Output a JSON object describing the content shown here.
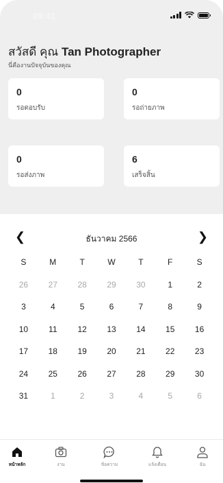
{
  "status_bar": {
    "time": "09:41"
  },
  "header": {
    "greeting_prefix": "สวัสดี คุณ",
    "user_name": "Tan Photographer",
    "subtitle": "นี่คืองานปัจจุบันของคุณ"
  },
  "stats": [
    {
      "value": "0",
      "label": "รอตอบรับ"
    },
    {
      "value": "0",
      "label": "รอถ่ายภาพ"
    },
    {
      "value": "0",
      "label": "รอส่งภาพ"
    },
    {
      "value": "6",
      "label": "เสร็จสิ้น"
    }
  ],
  "calendar": {
    "month_title": "ธันวาคม 2566",
    "prev_icon": "chevron-left-icon",
    "next_icon": "chevron-right-icon",
    "weekdays": [
      "S",
      "M",
      "T",
      "W",
      "T",
      "F",
      "S"
    ],
    "weeks": [
      [
        {
          "d": "26",
          "m": true
        },
        {
          "d": "27",
          "m": true
        },
        {
          "d": "28",
          "m": true
        },
        {
          "d": "29",
          "m": true
        },
        {
          "d": "30",
          "m": true
        },
        {
          "d": "1",
          "m": false
        },
        {
          "d": "2",
          "m": false
        }
      ],
      [
        {
          "d": "3",
          "m": false
        },
        {
          "d": "4",
          "m": false
        },
        {
          "d": "5",
          "m": false
        },
        {
          "d": "6",
          "m": false
        },
        {
          "d": "7",
          "m": false
        },
        {
          "d": "8",
          "m": false
        },
        {
          "d": "9",
          "m": false
        }
      ],
      [
        {
          "d": "10",
          "m": false
        },
        {
          "d": "11",
          "m": false
        },
        {
          "d": "12",
          "m": false
        },
        {
          "d": "13",
          "m": false
        },
        {
          "d": "14",
          "m": false
        },
        {
          "d": "15",
          "m": false
        },
        {
          "d": "16",
          "m": false
        }
      ],
      [
        {
          "d": "17",
          "m": false
        },
        {
          "d": "18",
          "m": false
        },
        {
          "d": "19",
          "m": false
        },
        {
          "d": "20",
          "m": false
        },
        {
          "d": "21",
          "m": false
        },
        {
          "d": "22",
          "m": false
        },
        {
          "d": "23",
          "m": false
        }
      ],
      [
        {
          "d": "24",
          "m": false
        },
        {
          "d": "25",
          "m": false
        },
        {
          "d": "26",
          "m": false
        },
        {
          "d": "27",
          "m": false
        },
        {
          "d": "28",
          "m": false
        },
        {
          "d": "29",
          "m": false
        },
        {
          "d": "30",
          "m": false
        }
      ],
      [
        {
          "d": "31",
          "m": false
        },
        {
          "d": "1",
          "m": true
        },
        {
          "d": "2",
          "m": true
        },
        {
          "d": "3",
          "m": true
        },
        {
          "d": "4",
          "m": true
        },
        {
          "d": "5",
          "m": true
        },
        {
          "d": "6",
          "m": true
        }
      ]
    ]
  },
  "bottom_nav": [
    {
      "label": "หน้าหลัก",
      "icon": "home-icon",
      "active": true
    },
    {
      "label": "งาน",
      "icon": "camera-icon",
      "active": false
    },
    {
      "label": "ข้อความ",
      "icon": "chat-icon",
      "active": false
    },
    {
      "label": "แจ้งเตือน",
      "icon": "bell-icon",
      "active": false
    },
    {
      "label": "ฉัน",
      "icon": "profile-icon",
      "active": false
    }
  ]
}
